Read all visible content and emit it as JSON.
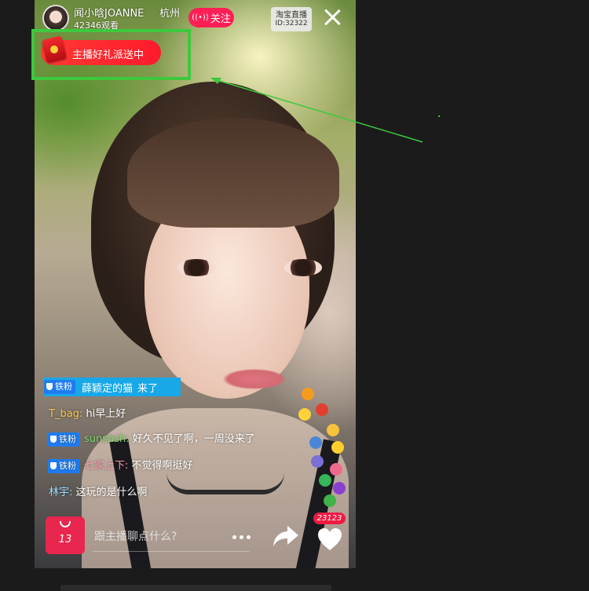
{
  "header": {
    "anchor_name": "闻小晗JOANNE",
    "city": "杭州",
    "viewers": "42346观看",
    "follow_label": "关注",
    "follow_icon": "live-radio-icon",
    "platform_name": "淘宝直播",
    "room_id": "ID:32322",
    "close_icon": "close-icon"
  },
  "gift_banner": {
    "text": "主播好礼派送中",
    "icon": "red-envelope-icon"
  },
  "comments": {
    "badge_label": "铁粉",
    "join": {
      "user": "薛颖定的猫",
      "action": "来了"
    },
    "messages": [
      {
        "user": "T_bag:",
        "text": "hi早上好",
        "has_badge": false
      },
      {
        "user": "sunshsh:",
        "text": "好久不见了啊，一周没来了",
        "has_badge": true
      },
      {
        "user": "七家上下:",
        "text": "不觉得啊挺好",
        "has_badge": true
      },
      {
        "user": "林宇:",
        "text": "这玩的是什么啊",
        "has_badge": false
      }
    ]
  },
  "bottom_bar": {
    "cart_count": "13",
    "cart_icon": "shopping-bag-icon",
    "chat_placeholder": "跟主播聊点什么?",
    "more_icon": "more-dots-icon",
    "share_icon": "share-arrow-icon",
    "like_count": "23123",
    "like_icon": "heart-icon"
  },
  "colors": {
    "accent_red": "#ff1f55",
    "badge_blue": "#1e7cf0",
    "annotation_green": "#3ec83e",
    "background": "#1b1b1b"
  }
}
